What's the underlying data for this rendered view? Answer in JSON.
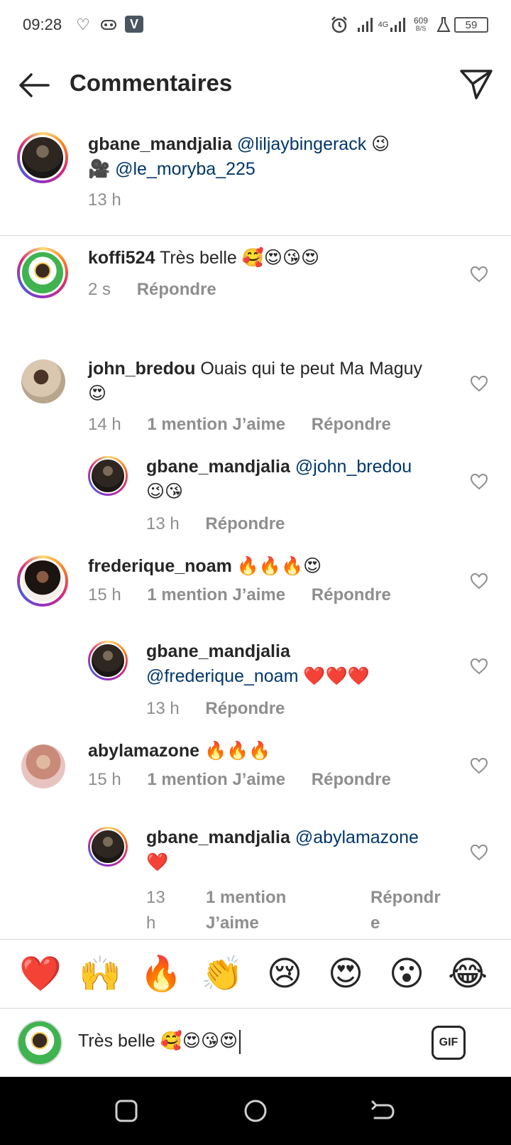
{
  "status_bar": {
    "time": "09:28",
    "net_speed_value": "609",
    "net_speed_unit": "B/S",
    "network_type": "4G",
    "battery": "59"
  },
  "header": {
    "title": "Commentaires"
  },
  "caption": {
    "username": "gbane_mandjalia",
    "mention1": "@liljaybingerack",
    "emoji1": "😉",
    "camera": "🎥",
    "mention2": "@le_moryba_225",
    "time": "13 h"
  },
  "comments": [
    {
      "username": "koffi524",
      "text": "Très belle 🥰😍😘😍",
      "time": "2 s",
      "reply_label": "Répondre"
    },
    {
      "username": "john_bredou",
      "text": "Ouais qui te peut Ma Maguy",
      "text2": "😍",
      "time": "14 h",
      "likes": "1 mention J’aime",
      "reply_label": "Répondre",
      "reply": {
        "username": "gbane_mandjalia",
        "mention": "@john_bredou",
        "text": "😉😘",
        "time": "13 h",
        "reply_label": "Répondre"
      }
    },
    {
      "username": "frederique_noam",
      "text": "🔥🔥🔥😍",
      "time": "15 h",
      "likes": "1 mention J’aime",
      "reply_label": "Répondre",
      "reply": {
        "username": "gbane_mandjalia",
        "mention": "@frederique_noam",
        "text": "❤️❤️❤️",
        "time": "13 h",
        "reply_label": "Répondre"
      }
    },
    {
      "username": "abylamazone",
      "text": "🔥🔥🔥",
      "time": "15 h",
      "likes": "1 mention J’aime",
      "reply_label": "Répondre",
      "reply": {
        "username": "gbane_mandjalia",
        "mention": "@abylamazone",
        "text": "❤️",
        "time_line1": "13",
        "time_line2": "h",
        "likes_line1": "1 mention",
        "likes_line2": "J’aime",
        "reply_line1": "Répondr",
        "reply_line2": "e"
      }
    }
  ],
  "emoji_bar": [
    "❤️",
    "🙌",
    "🔥",
    "👏",
    "😢",
    "😍",
    "😮",
    "😂"
  ],
  "input": {
    "value": "Très belle 🥰😍😘😍",
    "gif_label": "GIF"
  },
  "icons": {
    "back": "arrow-left",
    "send": "paper-plane",
    "like": "heart-outline"
  }
}
